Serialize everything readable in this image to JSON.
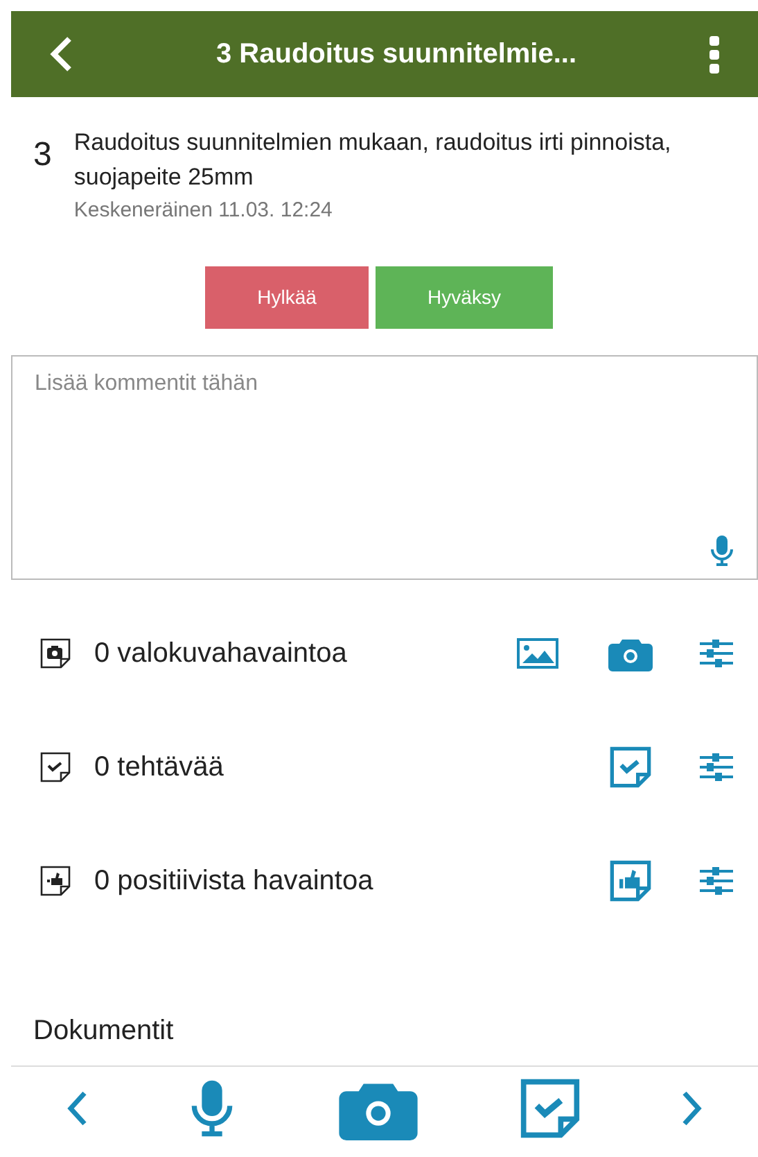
{
  "header": {
    "title": "3 Raudoitus suunnitelmie..."
  },
  "item": {
    "number": "3",
    "description": "Raudoitus suunnitelmien mukaan, raudoitus irti pinnoista, suojapeite 25mm",
    "status": "Keskeneräinen 11.03. 12:24"
  },
  "buttons": [
    {
      "label": "Hylkää",
      "kind": "reject"
    },
    {
      "label": "Hyväksy",
      "kind": "approve"
    }
  ],
  "comment": {
    "placeholder": "Lisää kommentit tähän"
  },
  "rows": [
    {
      "kind": "photo",
      "label": "0 valokuvahavaintoa"
    },
    {
      "kind": "task",
      "label": "0 tehtävää"
    },
    {
      "kind": "positive",
      "label": "0 positiivista havaintoa"
    }
  ],
  "section": {
    "title": "Dokumentit"
  }
}
